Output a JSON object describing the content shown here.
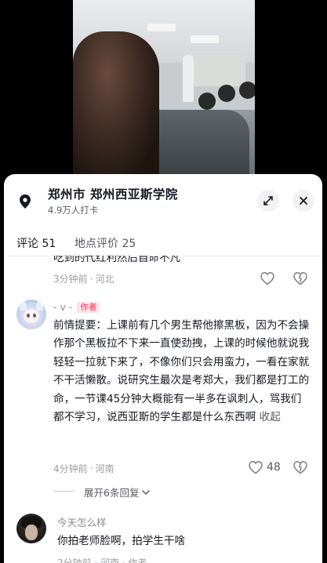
{
  "location": {
    "title": "郑州市  郑州西亚斯学院",
    "checkins": "4.9万人打卡"
  },
  "tabs": [
    {
      "label": "评论 51",
      "active": true
    },
    {
      "label": "地点评价 25",
      "active": false
    }
  ],
  "comments": [
    {
      "partial_text": "吃到的代红利然后自命不凡",
      "time": "3分钟前",
      "region": "河北"
    },
    {
      "username": "- v -",
      "badge": "作者",
      "text": "前情提要：上课前有几个男生帮他擦黑板，因为不会操作那个黑板拉不下来一直使劲拽，上课的时候他就说我轻轻一拉就下来了，不像你们只会用蛮力，一看在家就不干活懒散。说研究生最次是考郑大，我们都是打工的命，一节课45分钟大概能有一半多在讽刺人，骂我们都不学习，说西亚斯的学生都是什么东西啊",
      "collapse_label": "收起",
      "time": "4分钟前",
      "region": "河南",
      "likes": "48",
      "expand_label": "展开6条回复"
    },
    {
      "username": "今天怎么样",
      "text": "你拍老师脸啊，拍学生干啥",
      "meta_partial": "2分钟前 · 河南 · 作者"
    }
  ],
  "colors": {
    "author_badge": "#fe2c55",
    "text_primary": "#161823",
    "text_secondary": "#9c9da3"
  }
}
